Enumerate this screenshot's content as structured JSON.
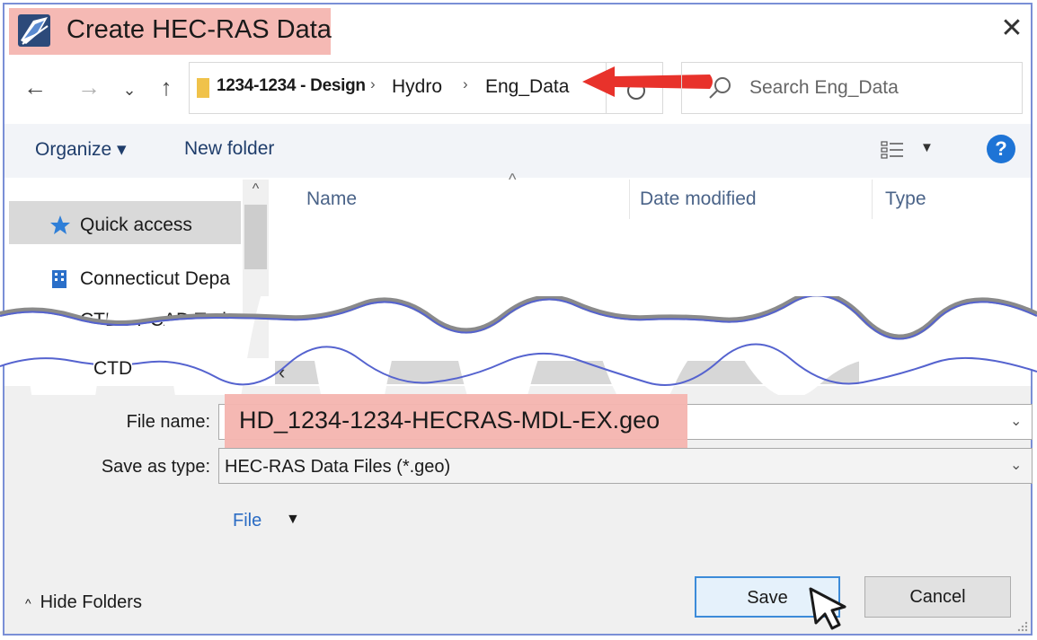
{
  "window": {
    "title": "Create HEC-RAS Data",
    "close_glyph": "✕"
  },
  "address": {
    "back_glyph": "←",
    "forward_glyph": "→",
    "recent_glyph": "⌄",
    "up_glyph": "↑",
    "breadcrumbs": [
      "1234-1234 - Design",
      "Hydro",
      "Eng_Data"
    ],
    "separator": "›",
    "search_placeholder": "Search Eng_Data"
  },
  "toolbar": {
    "organize_label": "Organize ▾",
    "new_folder_label": "New folder",
    "help_glyph": "?"
  },
  "nav_pane": {
    "items": [
      {
        "label": "Quick access",
        "icon": "star-icon",
        "selected": true
      },
      {
        "label": "Connecticut Depa",
        "icon": "building-icon",
        "selected": false
      },
      {
        "label": "CTDOT CAD Trai",
        "icon": "folder-icon",
        "selected": false
      },
      {
        "label": "CTD",
        "icon": "folder-icon",
        "selected": false
      }
    ]
  },
  "file_list": {
    "columns": [
      "Name",
      "Date modified",
      "Type"
    ],
    "sort_glyph": "^"
  },
  "form": {
    "file_name_label": "File name:",
    "file_name_value": "HD_1234-1234-HECRAS-MDL-EX.geo",
    "save_type_label": "Save as type:",
    "save_type_value": "HEC-RAS Data Files (*.geo)",
    "file_link_label": "File"
  },
  "footer": {
    "hide_folders_label": "Hide Folders",
    "save_label": "Save",
    "cancel_label": "Cancel"
  },
  "colors": {
    "highlight": "#f5b9b4",
    "arrow": "#e8322b",
    "break_line": "#5563cf",
    "link": "#2b6cc4"
  }
}
